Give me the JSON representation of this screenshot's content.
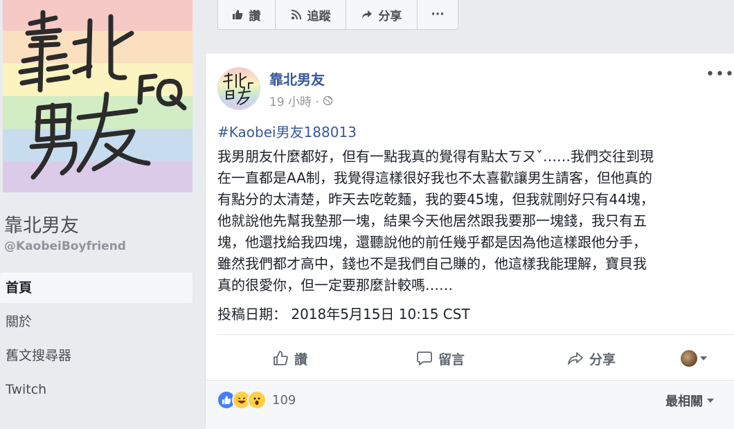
{
  "sidebar": {
    "cover_art_text": [
      "靠北",
      "男友",
      "FQ"
    ],
    "page_name": "靠北男友",
    "page_handle": "@KaobeiBoyfriend",
    "nav": [
      {
        "label": "首頁",
        "active": true
      },
      {
        "label": "關於",
        "active": false
      },
      {
        "label": "舊文搜尋器",
        "active": false
      },
      {
        "label": "Twitch",
        "active": false
      }
    ]
  },
  "topbar": {
    "like": {
      "label": "讚",
      "icon": "thumbs-up-icon"
    },
    "follow": {
      "label": "追蹤",
      "icon": "rss-icon"
    },
    "share": {
      "label": "分享",
      "icon": "share-arrow-icon"
    },
    "more": {
      "label": "···",
      "icon": "more-dots-icon"
    }
  },
  "post": {
    "author": "靠北男友",
    "time": "19 小時 ·",
    "privacy_icon": "globe-icon",
    "more": "•••",
    "hashtag": "#Kaobei男友188013",
    "body_lines": [
      "我男朋友什麼都好，但有一點我真的覺得有點太ㄎㄡˇ……我們交往到現",
      "在一直都是AA制，我覺得這樣很好我也不太喜歡讓男生請客，但他真的",
      "有點分的太清楚，昨天去吃乾麵，我的要45塊，但我就剛好只有44塊，",
      "他就說他先幫我墊那一塊，結果今天他居然跟我要那一塊錢，我只有五",
      "塊，他還找給我四塊，還聽說他的前任幾乎都是因為他這樣跟他分手，",
      "雖然我們都才高中，錢也不是我們自己賺的，他這樣我能理解，寶貝我",
      "真的很愛你，但一定要那麼計較嗎……"
    ],
    "posted_at": "投稿日期： 2018年5月15日 10:15 CST",
    "actions": {
      "like": "讚",
      "comment": "留言",
      "share": "分享"
    },
    "reactions": {
      "types": [
        "like",
        "haha",
        "wow"
      ],
      "count": "109"
    },
    "sort_label": "最相關",
    "colors": {
      "link": "#365899",
      "like_blue": "#4080ff",
      "emoji_yellow": "#ffd046"
    }
  }
}
